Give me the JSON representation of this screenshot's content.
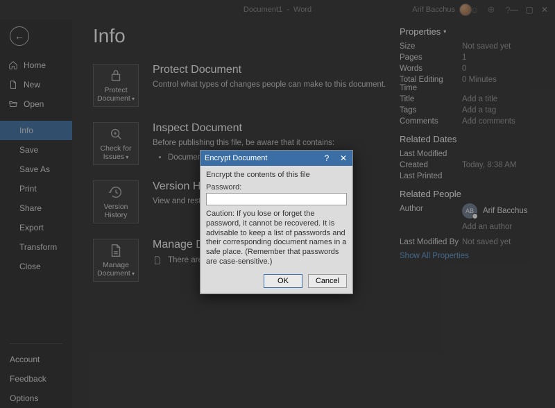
{
  "titlebar": {
    "document_name": "Document1",
    "app_name": "Word",
    "user_name": "Arif Bacchus",
    "help_symbol": "?",
    "min_symbol": "—",
    "max_symbol": "▢",
    "close_symbol": "✕"
  },
  "sidebar": {
    "back_symbol": "←",
    "items": [
      {
        "icon": "home",
        "label": "Home"
      },
      {
        "icon": "new",
        "label": "New"
      },
      {
        "icon": "open",
        "label": "Open"
      }
    ],
    "simple_items": [
      "Info",
      "Save",
      "Save As",
      "Print",
      "Share",
      "Export",
      "Transform",
      "Close"
    ],
    "selected_simple_index": 0,
    "bottom_items": [
      "Account",
      "Feedback",
      "Options"
    ]
  },
  "page": {
    "title": "Info"
  },
  "sections": {
    "protect": {
      "tile_label_line1": "Protect",
      "tile_label_line2": "Document",
      "heading": "Protect Document",
      "desc": "Control what types of changes people can make to this document."
    },
    "inspect": {
      "tile_label_line1": "Check for",
      "tile_label_line2": "Issues",
      "heading": "Inspect Document",
      "desc_prefix": "Before publishing this file, be aware that it contains:",
      "bullet1": "Document properties and author's name"
    },
    "version": {
      "tile_label_line1": "Version",
      "tile_label_line2": "History",
      "heading": "Version History",
      "desc": "View and restore previous versions."
    },
    "manage": {
      "tile_label_line1": "Manage",
      "tile_label_line2": "Document",
      "heading": "Manage Document",
      "no_changes": "There are no unsaved changes."
    }
  },
  "properties": {
    "heading": "Properties",
    "rows": [
      {
        "label": "Size",
        "value": "Not saved yet",
        "interactive": false
      },
      {
        "label": "Pages",
        "value": "1",
        "interactive": false
      },
      {
        "label": "Words",
        "value": "0",
        "interactive": false
      },
      {
        "label": "Total Editing Time",
        "value": "0 Minutes",
        "interactive": false
      },
      {
        "label": "Title",
        "value": "Add a title",
        "interactive": true
      },
      {
        "label": "Tags",
        "value": "Add a tag",
        "interactive": true
      },
      {
        "label": "Comments",
        "value": "Add comments",
        "interactive": true
      }
    ],
    "related_dates_heading": "Related Dates",
    "date_rows": [
      {
        "label": "Last Modified",
        "value": ""
      },
      {
        "label": "Created",
        "value": "Today, 8:38 AM"
      },
      {
        "label": "Last Printed",
        "value": ""
      }
    ],
    "related_people_heading": "Related People",
    "author_label": "Author",
    "author_initials": "AB",
    "author_name": "Arif Bacchus",
    "add_author": "Add an author",
    "last_modified_by_label": "Last Modified By",
    "last_modified_by_value": "Not saved yet",
    "show_all": "Show All Properties"
  },
  "dialog": {
    "title": "Encrypt Document",
    "help_symbol": "?",
    "close_symbol": "✕",
    "line1": "Encrypt the contents of this file",
    "password_label": "Password:",
    "password_value": "",
    "caution": "Caution: If you lose or forget the password, it cannot be recovered. It is advisable to keep a list of passwords and their corresponding document names in a safe place. (Remember that passwords are case-sensitive.)",
    "ok": "OK",
    "cancel": "Cancel"
  }
}
